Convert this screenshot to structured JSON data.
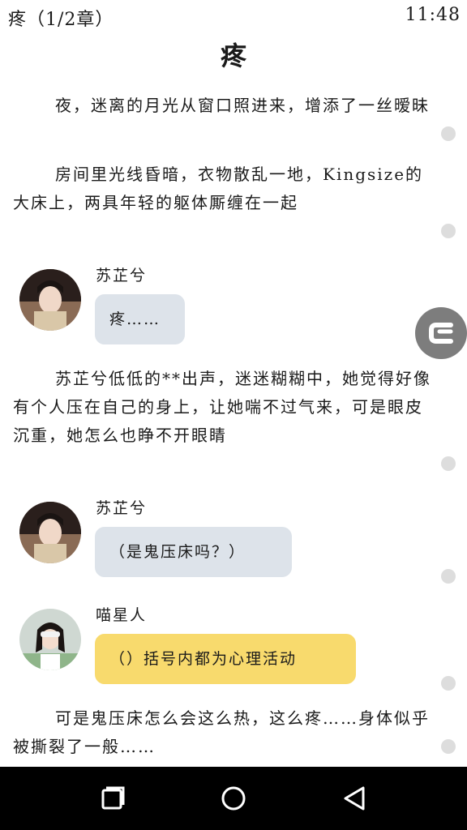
{
  "status": {
    "title": "疼（1/2章）",
    "time": "11:48"
  },
  "chapter": {
    "title": "疼"
  },
  "content": {
    "para1": "夜，迷离的月光从窗口照进来，增添了一丝暧昧",
    "para2": "房间里光线昏暗，衣物散乱一地，Kingsize的大床上，两具年轻的躯体厮缠在一起",
    "msg1": {
      "speaker": "苏芷兮",
      "text": "疼……"
    },
    "para3": "苏芷兮低低的**出声，迷迷糊糊中，她觉得好像有个人压在自己的身上，让她喘不过气来，可是眼皮沉重，她怎么也睁不开眼睛",
    "msg2": {
      "speaker": "苏芷兮",
      "text": "（是鬼压床吗？）"
    },
    "msg3": {
      "speaker": "喵星人",
      "text": "（）括号内都为心理活动"
    },
    "para4": "可是鬼压床怎么会这么热，这么疼……身体似乎被撕裂了一般……"
  },
  "colors": {
    "bubble_blue": "#dde3ea",
    "bubble_yellow": "#f8da6d",
    "nav_bar": "#000000",
    "float_button": "#7d7d7d"
  },
  "icons": {
    "float": "c-letter-icon",
    "recent": "recent-apps-icon",
    "home": "home-icon",
    "back": "back-icon"
  }
}
